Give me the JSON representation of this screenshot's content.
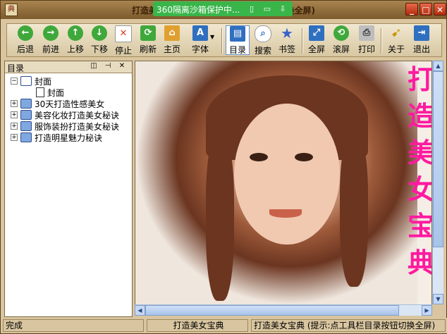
{
  "window": {
    "title": "打造美女宝典 (提示:点工具栏目录按钮切换全屏)",
    "sandbox_label": "360隔离沙箱保护中...",
    "controls": {
      "minimize": "_",
      "maximize": "□",
      "close": "✕"
    }
  },
  "toolbar": {
    "buttons": [
      {
        "label": "后退",
        "icon": "back-arrow-icon",
        "color": "#3fa83b"
      },
      {
        "label": "前进",
        "icon": "forward-arrow-icon",
        "color": "#3fa83b"
      },
      {
        "label": "上移",
        "icon": "up-arrow-icon",
        "color": "#3fa83b"
      },
      {
        "label": "下移",
        "icon": "down-arrow-icon",
        "color": "#3fa83b"
      },
      {
        "label": "停止",
        "icon": "stop-icon",
        "color": "#d93a2a"
      },
      {
        "label": "刷新",
        "icon": "refresh-icon",
        "color": "#3fa83b"
      },
      {
        "label": "主页",
        "icon": "home-icon",
        "color": "#e0a030"
      },
      {
        "label": "字体",
        "icon": "font-icon",
        "color": "#2f6fc0"
      },
      {
        "label": "目录",
        "icon": "contents-icon",
        "color": "#2f6fc0"
      },
      {
        "label": "搜索",
        "icon": "search-icon",
        "color": "#2f6fc0"
      },
      {
        "label": "书签",
        "icon": "bookmark-star-icon",
        "color": "#3a62c9"
      },
      {
        "label": "全屏",
        "icon": "fullscreen-icon",
        "color": "#2f6fc0"
      },
      {
        "label": "滚屏",
        "icon": "scroll-icon",
        "color": "#3fa83b"
      },
      {
        "label": "打印",
        "icon": "printer-icon",
        "color": "#707070"
      },
      {
        "label": "关于",
        "icon": "about-icon",
        "color": "#e0b030"
      },
      {
        "label": "退出",
        "icon": "exit-icon",
        "color": "#2f6fc0"
      }
    ]
  },
  "panel": {
    "title": "目录",
    "tree": [
      {
        "label": "封面",
        "expanded": true
      },
      {
        "label": "封面",
        "child": true
      },
      {
        "label": "30天打造性感美女"
      },
      {
        "label": "美容化妆打造美女秘诀"
      },
      {
        "label": "服饰装扮打造美女秘诀"
      },
      {
        "label": "打造明星魅力秘诀"
      }
    ]
  },
  "content": {
    "banner_text": [
      "打",
      "造",
      "美",
      "女",
      "宝",
      "典"
    ],
    "colors": {
      "banner": "#ff1aa0"
    }
  },
  "status": {
    "left": "完成",
    "middle": "打造美女宝典",
    "right": "打造美女宝典 (提示:点工具栏目录按钮切换全屏)"
  }
}
